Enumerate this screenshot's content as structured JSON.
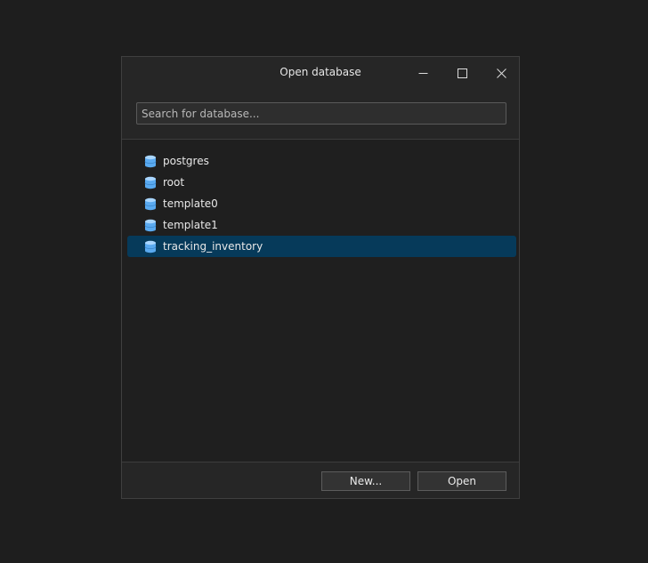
{
  "window": {
    "title": "Open database"
  },
  "search": {
    "placeholder": "Search for database...",
    "value": ""
  },
  "databases": [
    {
      "name": "postgres",
      "icon": "database-icon",
      "selected": false
    },
    {
      "name": "root",
      "icon": "database-icon",
      "selected": false
    },
    {
      "name": "template0",
      "icon": "database-icon",
      "selected": false
    },
    {
      "name": "template1",
      "icon": "database-icon",
      "selected": false
    },
    {
      "name": "tracking_inventory",
      "icon": "database-icon",
      "selected": true
    }
  ],
  "footer": {
    "new_label": "New...",
    "open_label": "Open"
  },
  "colors": {
    "background": "#1e1e1e",
    "dialog": "#262626",
    "list": "#1f1f1f",
    "selection": "#063a5a",
    "db_icon": "#5aaaf0"
  }
}
